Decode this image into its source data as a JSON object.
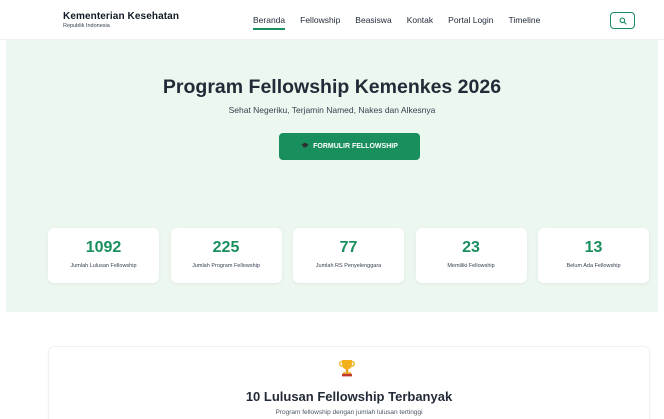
{
  "header": {
    "brand_title": "Kementerian Kesehatan",
    "brand_sub": "Republik Indonesia",
    "nav": [
      "Beranda",
      "Fellowship",
      "Beasiswa",
      "Kontak",
      "Portal Login",
      "Timeline"
    ],
    "active_nav": "Beranda",
    "search_icon": "search-icon"
  },
  "hero": {
    "title": "Program Fellowship Kemenkes 2026",
    "subtitle": "Sehat Negeriku, Terjamin Named, Nakes dan Alkesnya",
    "cta_label": "FORMULIR FELLOWSHIP",
    "cta_icon": "graduation-cap-icon"
  },
  "stats": [
    {
      "value": "1092",
      "label": "Jumlah Lulusan Fellowship"
    },
    {
      "value": "225",
      "label": "Jumlah Program Fellowship"
    },
    {
      "value": "77",
      "label": "Jumlah RS Penyelenggara"
    },
    {
      "value": "23",
      "label": "Memiliki Fellowship"
    },
    {
      "value": "13",
      "label": "Belum Ada Fellowship"
    }
  ],
  "top_graduates": {
    "icon": "trophy-icon",
    "title": "10 Lulusan Fellowship Terbanyak",
    "subtitle": "Program fellowship dengan jumlah lulusan tertinggi"
  },
  "colors": {
    "accent": "#1a8f5e",
    "hero_bg": "#ecf7ef",
    "text_dark": "#232b38"
  }
}
